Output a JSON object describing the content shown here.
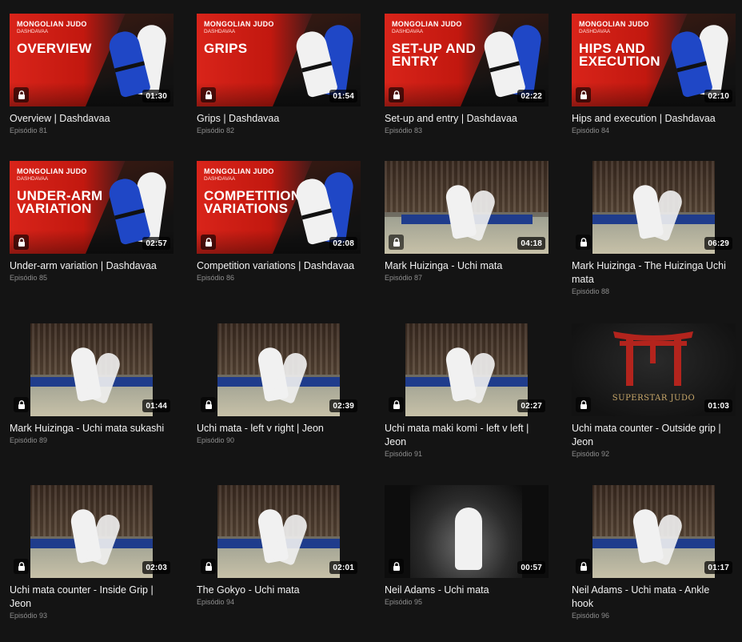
{
  "brand": {
    "label": "MONGOLIAN JUDO",
    "sub": "DASHDAVAA"
  },
  "episodes": [
    {
      "title": "Overview | Dashdavaa",
      "episode": "Episódio 81",
      "duration": "01:30",
      "thumb_text": "OVERVIEW",
      "style": "brand",
      "figure": "blue"
    },
    {
      "title": "Grips | Dashdavaa",
      "episode": "Episódio 82",
      "duration": "01:54",
      "thumb_text": "GRIPS",
      "style": "brand",
      "figure": "white"
    },
    {
      "title": "Set-up and entry | Dashdavaa",
      "episode": "Episódio 83",
      "duration": "02:22",
      "thumb_text": "SET-UP AND ENTRY",
      "style": "brand",
      "figure": "white"
    },
    {
      "title": "Hips and execution | Dashdavaa",
      "episode": "Episódio 84",
      "duration": "02:10",
      "thumb_text": "HIPS AND EXECUTION",
      "style": "brand",
      "figure": "blue"
    },
    {
      "title": "Under-arm variation | Dashdavaa",
      "episode": "Episódio 85",
      "duration": "02:57",
      "thumb_text": "UNDER-ARM VARIATION",
      "style": "brand",
      "figure": "blue"
    },
    {
      "title": "Competition variations | Dashdavaa",
      "episode": "Episódio 86",
      "duration": "02:08",
      "thumb_text": "COMPETITION VARIATIONS",
      "style": "brand",
      "figure": "white"
    },
    {
      "title": "Mark Huizinga - Uchi mata",
      "episode": "Episódio 87",
      "duration": "04:18",
      "style": "arena"
    },
    {
      "title": "Mark Huizinga - The Huizinga Uchi mata",
      "episode": "Episódio 88",
      "duration": "06:29",
      "style": "arena_box"
    },
    {
      "title": "Mark Huizinga - Uchi mata sukashi",
      "episode": "Episódio 89",
      "duration": "01:44",
      "style": "arena_box"
    },
    {
      "title": "Uchi mata - left v right | Jeon",
      "episode": "Episódio 90",
      "duration": "02:39",
      "style": "arena_box"
    },
    {
      "title": "Uchi mata maki komi - left v left | Jeon",
      "episode": "Episódio 91",
      "duration": "02:27",
      "style": "arena_box"
    },
    {
      "title": "Uchi mata counter - Outside grip | Jeon",
      "episode": "Episódio 92",
      "duration": "01:03",
      "style": "torii",
      "thumb_text": "SUPERSTAR JUDO"
    },
    {
      "title": "Uchi mata counter - Inside Grip | Jeon",
      "episode": "Episódio 93",
      "duration": "02:03",
      "style": "arena_box"
    },
    {
      "title": "The Gokyo - Uchi mata",
      "episode": "Episódio 94",
      "duration": "02:01",
      "style": "arena_box"
    },
    {
      "title": "Neil Adams - Uchi mata",
      "episode": "Episódio 95",
      "duration": "00:57",
      "style": "dark_box"
    },
    {
      "title": "Neil Adams - Uchi mata - Ankle hook",
      "episode": "Episódio 96",
      "duration": "01:17",
      "style": "arena_box"
    }
  ],
  "colors": {
    "background": "#141414",
    "brand_red": "#d9241a",
    "gi_blue": "#1f47c6"
  },
  "icons": {
    "lock": "lock-icon"
  }
}
